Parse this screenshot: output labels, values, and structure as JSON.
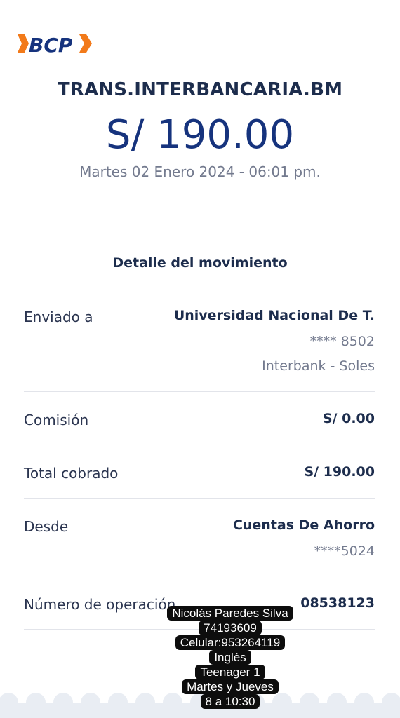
{
  "header": {
    "logo_text": "BCP",
    "transaction_type": "TRANS.INTERBANCARIA.BM",
    "amount": "S/ 190.00",
    "datetime": "Martes 02 Enero 2024 - 06:01 pm."
  },
  "detail": {
    "title": "Detalle del movimiento",
    "sent_to": {
      "label": "Enviado a",
      "value": "Universidad Nacional De T.",
      "account": "**** 8502",
      "bank": "Interbank - Soles"
    },
    "commission": {
      "label": "Comisión",
      "value": "S/ 0.00"
    },
    "total": {
      "label": "Total cobrado",
      "value": "S/ 190.00"
    },
    "from": {
      "label": "Desde",
      "value": "Cuentas De Ahorro",
      "account": "****5024"
    },
    "operation": {
      "label": "Número de operación",
      "value": "08538123"
    }
  },
  "sticker": {
    "lines": [
      "Nicolás Paredes Silva",
      "74193609",
      "Celular:953264119",
      "Inglés",
      "Teenager 1",
      "Martes y Jueves",
      "8 a 10:30"
    ]
  },
  "colors": {
    "brand_blue": "#16337d",
    "brand_orange": "#f27a1a",
    "text_dark": "#1d2d4d",
    "text_muted": "#737a8e",
    "divider": "#e2e4ea"
  }
}
